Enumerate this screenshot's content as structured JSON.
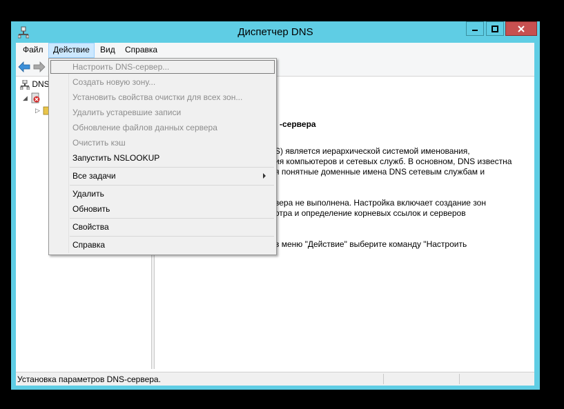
{
  "window": {
    "title": "Диспетчер DNS",
    "accent_color": "#5fcde4",
    "close_color": "#c75050"
  },
  "menubar": {
    "items": [
      "Файл",
      "Действие",
      "Вид",
      "Справка"
    ],
    "active": "Действие"
  },
  "toolbar": {
    "icons": [
      "back-arrow-icon",
      "forward-arrow-icon"
    ]
  },
  "tree": {
    "root_label": "DNS",
    "server_label": "",
    "icons": [
      "dns-server-icon",
      "server-error-icon",
      "folder-icon"
    ]
  },
  "detail": {
    "heading": "-сервера",
    "lines": [
      "S) является иерархической системой именования,",
      "ия компьютеров и сетевых служб. В основном, DNS известна",
      "я понятные доменные имена DNS сетевым службам и",
      "вера не выполнена. Настройка включает создание зон",
      "отра и определение корневых ссылок и серверов",
      "в меню \"Действие\" выберите команду \"Настроить"
    ]
  },
  "context_menu": {
    "items": [
      {
        "label": "Настроить DNS-сервер...",
        "disabled": true
      },
      {
        "label": "Создать новую зону...",
        "disabled": true
      },
      {
        "label": "Установить свойства очистки для всех зон...",
        "disabled": true
      },
      {
        "label": "Удалить устаревшие записи",
        "disabled": true
      },
      {
        "label": "Обновление файлов данных сервера",
        "disabled": true
      },
      {
        "label": "Очистить кэш",
        "disabled": true
      },
      {
        "label": "Запустить NSLOOKUP",
        "disabled": false
      },
      {
        "label": "Все задачи",
        "disabled": false,
        "submenu": true
      },
      {
        "label": "Удалить",
        "disabled": false
      },
      {
        "label": "Обновить",
        "disabled": false
      },
      {
        "label": "Свойства",
        "disabled": false
      },
      {
        "label": "Справка",
        "disabled": false
      }
    ]
  },
  "statusbar": {
    "text": "Установка параметров DNS-сервера."
  }
}
